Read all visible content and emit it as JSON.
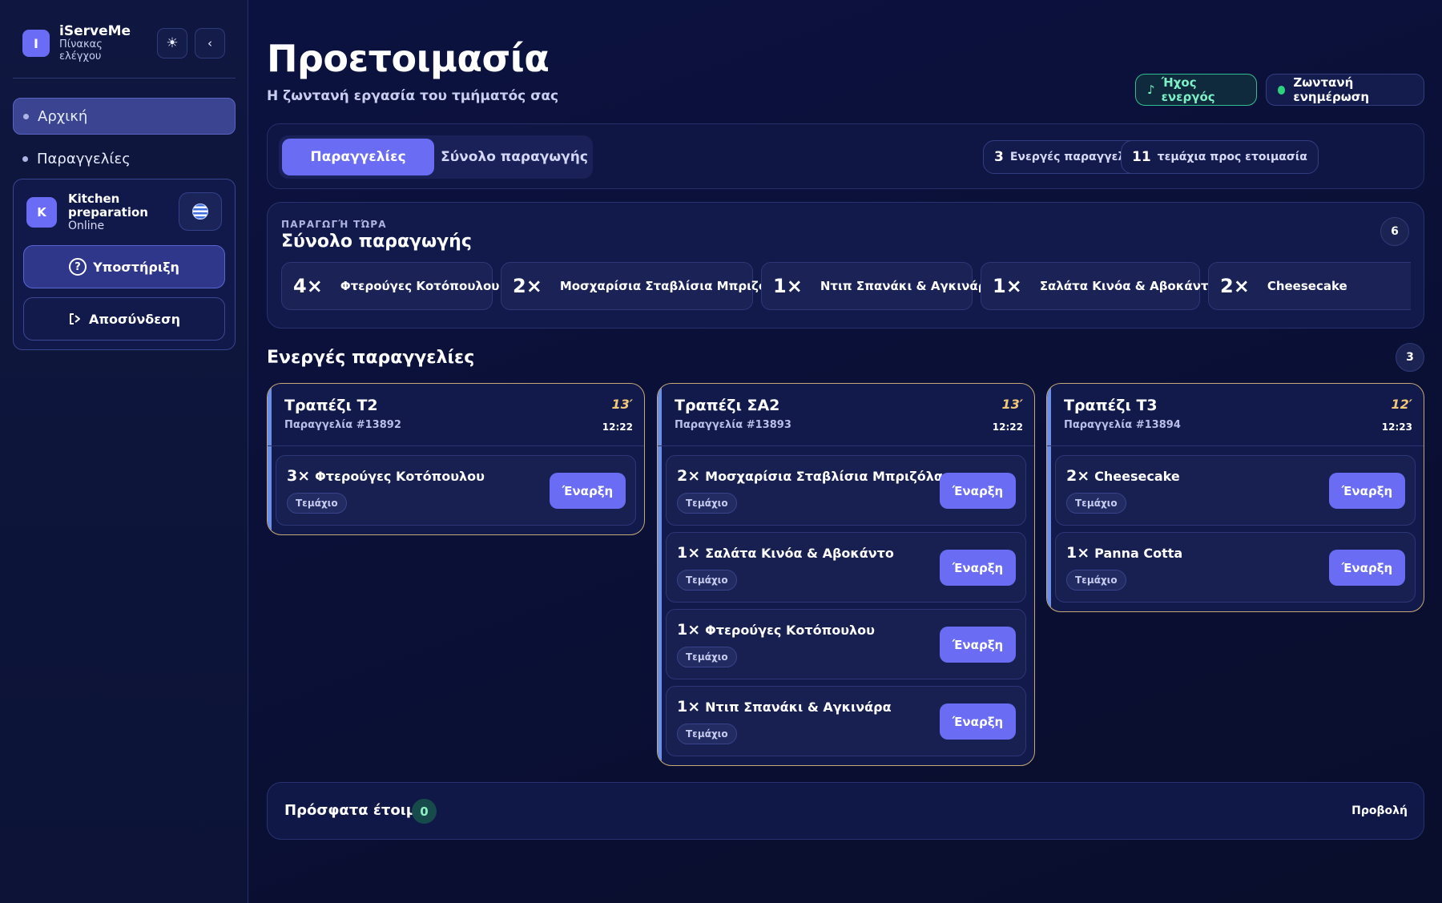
{
  "sidebar": {
    "brand_initial": "I",
    "brand_name": "iServeMe",
    "brand_sub": "Πίνακας ελέγχου",
    "nav": [
      {
        "label": "Αρχική",
        "active": true
      },
      {
        "label": "Παραγγελίες",
        "active": false
      }
    ],
    "user": {
      "initial": "K",
      "name": "Kitchen preparation",
      "status": "Online"
    },
    "support_label": "Υποστήριξη",
    "logout_label": "Αποσύνδεση"
  },
  "header": {
    "title": "Προετοιμασία",
    "subtitle": "Η ζωντανή εργασία του τμήματός σας",
    "sound_label": "Ήχος ενεργός",
    "live_label": "Ζωντανή ενημέρωση"
  },
  "toolbar": {
    "tabs": [
      "Παραγγελίες",
      "Σύνολο παραγωγής"
    ],
    "active_orders_count": "3",
    "active_orders_label": "Ενεργές παραγγελίες",
    "pieces_count": "11",
    "pieces_label": "τεμάχια προς ετοιμασία"
  },
  "production": {
    "kicker": "ΠΑΡΑΓΩΓΉ ΤΏΡΑ",
    "title": "Σύνολο παραγωγής",
    "count": "6",
    "chips": [
      {
        "qty": "4×",
        "name": "Φτερούγες Κοτόπουλου"
      },
      {
        "qty": "2×",
        "name": "Μοσχαρίσια Σταβλίσια Μπριζόλα"
      },
      {
        "qty": "1×",
        "name": "Ντιπ Σπανάκι & Αγκινάρα"
      },
      {
        "qty": "1×",
        "name": "Σαλάτα Κινόα & Αβοκάντο"
      },
      {
        "qty": "2×",
        "name": "Cheesecake"
      }
    ]
  },
  "active_orders": {
    "title": "Ενεργές παραγγελίες",
    "count": "3",
    "orders": [
      {
        "table": "Τραπέζι Τ2",
        "order": "Παραγγελία #13892",
        "minutes": "13′",
        "time": "12:22",
        "items": [
          {
            "qty": "3×",
            "name": "Φτερούγες Κοτόπουλου",
            "unit": "Τεμάχιο",
            "action": "Έναρξη"
          }
        ]
      },
      {
        "table": "Τραπέζι ΣΑ2",
        "order": "Παραγγελία #13893",
        "minutes": "13′",
        "time": "12:22",
        "items": [
          {
            "qty": "2×",
            "name": "Μοσχαρίσια Σταβλίσια Μπριζόλα",
            "unit": "Τεμάχιο",
            "action": "Έναρξη"
          },
          {
            "qty": "1×",
            "name": "Σαλάτα Κινόα & Αβοκάντο",
            "unit": "Τεμάχιο",
            "action": "Έναρξη"
          },
          {
            "qty": "1×",
            "name": "Φτερούγες Κοτόπουλου",
            "unit": "Τεμάχιο",
            "action": "Έναρξη"
          },
          {
            "qty": "1×",
            "name": "Ντιπ Σπανάκι & Αγκινάρα",
            "unit": "Τεμάχιο",
            "action": "Έναρξη"
          }
        ]
      },
      {
        "table": "Τραπέζι Τ3",
        "order": "Παραγγελία #13894",
        "minutes": "12′",
        "time": "12:23",
        "items": [
          {
            "qty": "2×",
            "name": "Cheesecake",
            "unit": "Τεμάχιο",
            "action": "Έναρξη"
          },
          {
            "qty": "1×",
            "name": "Panna Cotta",
            "unit": "Τεμάχιο",
            "action": "Έναρξη"
          }
        ]
      }
    ]
  },
  "recent": {
    "title": "Πρόσφατα έτοιμα",
    "count": "0",
    "view_label": "Προβολή"
  },
  "icons": {
    "theme": "sun-icon",
    "collapse": "chevron-left-icon",
    "sound": "music-note-icon",
    "support": "help-circle-icon",
    "logout": "logout-icon",
    "language": "greek-flag-icon"
  },
  "colors": {
    "accent": "#6a6cf4",
    "live": "#2dd17e",
    "timer": "#f1c779",
    "order_border": "#c7a879"
  }
}
